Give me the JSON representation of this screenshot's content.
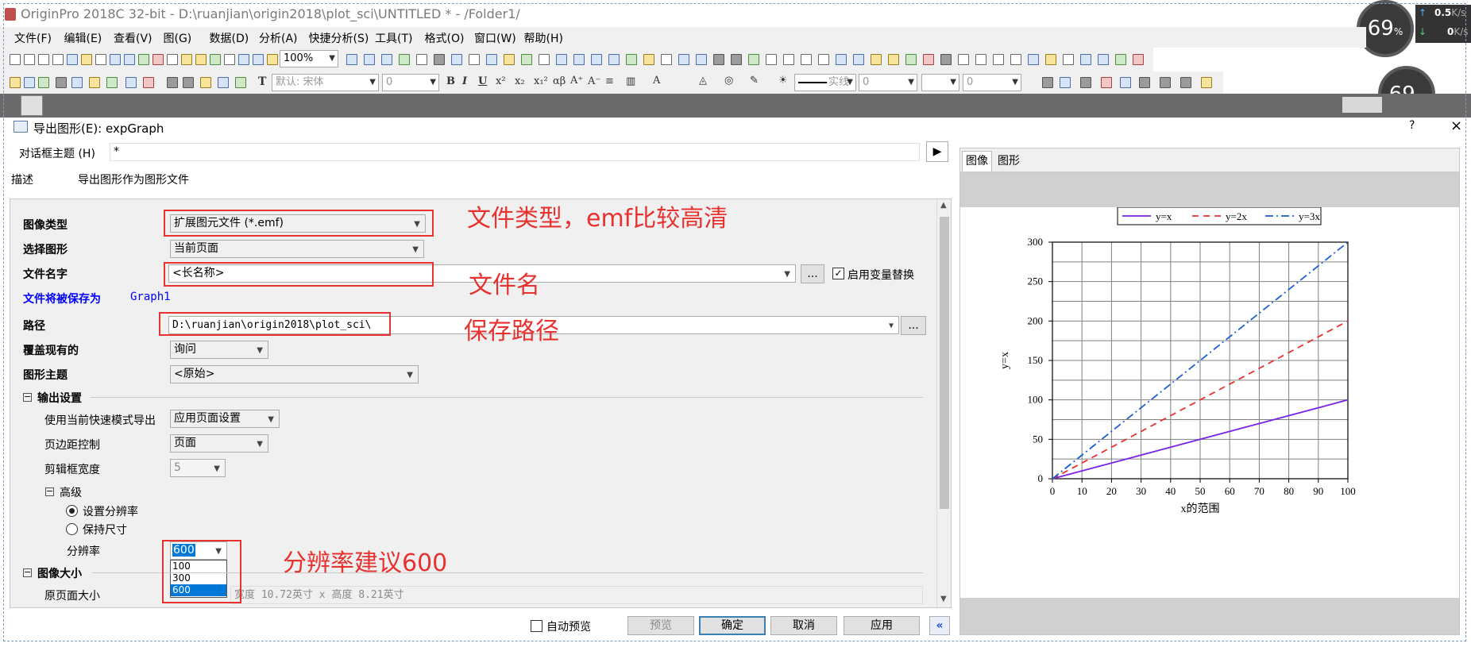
{
  "window": {
    "title": "OriginPro 2018C 32-bit - D:\\ruanjian\\origin2018\\plot_sci\\UNTITLED * - /Folder1/"
  },
  "menu": [
    "文件(F)",
    "编辑(E)",
    "查看(V)",
    "图(G)",
    "数据(D)",
    "分析(A)",
    "快捷分析(S)",
    "工具(T)",
    "格式(O)",
    "窗口(W)",
    "帮助(H)"
  ],
  "toolbar": {
    "zoom": "100%",
    "font": "默认: 宋体",
    "fontsize": "0",
    "line_style": "实线",
    "line_width": "0",
    "value3": "0"
  },
  "monitor": {
    "pct": "69",
    "pct_unit": "%",
    "up": "0.5",
    "up_unit": "K/s",
    "down": "0",
    "down_unit": "K/s"
  },
  "dialog": {
    "title": "导出图形(E): expGraph",
    "theme_label": "对话框主题 (H)",
    "theme_value": "*",
    "desc_label": "描述",
    "desc_value": "导出图形作为图形文件",
    "fields": {
      "image_type_label": "图像类型",
      "image_type_value": "扩展图元文件 (*.emf)",
      "select_graph_label": "选择图形",
      "select_graph_value": "当前页面",
      "file_name_label": "文件名字",
      "file_name_value": "<长名称>",
      "var_replace": "启用变量替换",
      "save_as_label": "文件将被保存为",
      "save_as_value": "Graph1",
      "path_label": "路径",
      "path_value": "D:\\ruanjian\\origin2018\\plot_sci\\",
      "overwrite_label": "覆盖现有的",
      "overwrite_value": "询问",
      "graph_theme_label": "图形主题",
      "graph_theme_value": "<原始>",
      "output_settings": "输出设置",
      "quick_mode_label": "使用当前快速模式导出",
      "quick_mode_value": "应用页面设置",
      "margin_label": "页边距控制",
      "margin_value": "页面",
      "clip_label": "剪辑框宽度",
      "clip_value": "5",
      "advanced": "高级",
      "set_res": "设置分辨率",
      "keep_size": "保持尺寸",
      "res_label": "分辨率",
      "res_value": "600",
      "res_options": [
        "100",
        "300",
        "600"
      ],
      "image_size": "图像大小",
      "orig_size_label": "原页面大小",
      "orig_size_value": "宽度 10.72英寸 x 高度 8.21英寸"
    },
    "buttons": {
      "auto_preview": "自动预览",
      "preview": "预览",
      "ok": "确定",
      "cancel": "取消",
      "apply": "应用",
      "ellipsis": "...",
      "play": "▶",
      "collapse": "«"
    },
    "tabs": [
      "图像",
      "图形"
    ]
  },
  "annotations": {
    "file_type": "文件类型，emf比较高清",
    "file_name": "文件名",
    "save_path": "保存路径",
    "resolution": "分辨率建议600"
  },
  "chart_data": {
    "type": "line",
    "title": "",
    "xlabel": "x的范围",
    "ylabel": "y=x",
    "xlim": [
      0,
      100
    ],
    "ylim": [
      0,
      300
    ],
    "xticks": [
      0,
      10,
      20,
      30,
      40,
      50,
      60,
      70,
      80,
      90,
      100
    ],
    "yticks": [
      0,
      50,
      100,
      150,
      200,
      250,
      300
    ],
    "grid": true,
    "legend_position": "top",
    "series": [
      {
        "name": "y=x",
        "x": [
          0,
          100
        ],
        "y": [
          0,
          100
        ],
        "color": "#7b22e6",
        "style": "solid"
      },
      {
        "name": "y=2x",
        "x": [
          0,
          100
        ],
        "y": [
          0,
          200
        ],
        "color": "#e8322f",
        "style": "dash"
      },
      {
        "name": "y=3x",
        "x": [
          0,
          100
        ],
        "y": [
          0,
          300
        ],
        "color": "#1c5fd1",
        "style": "dashdot"
      }
    ]
  }
}
